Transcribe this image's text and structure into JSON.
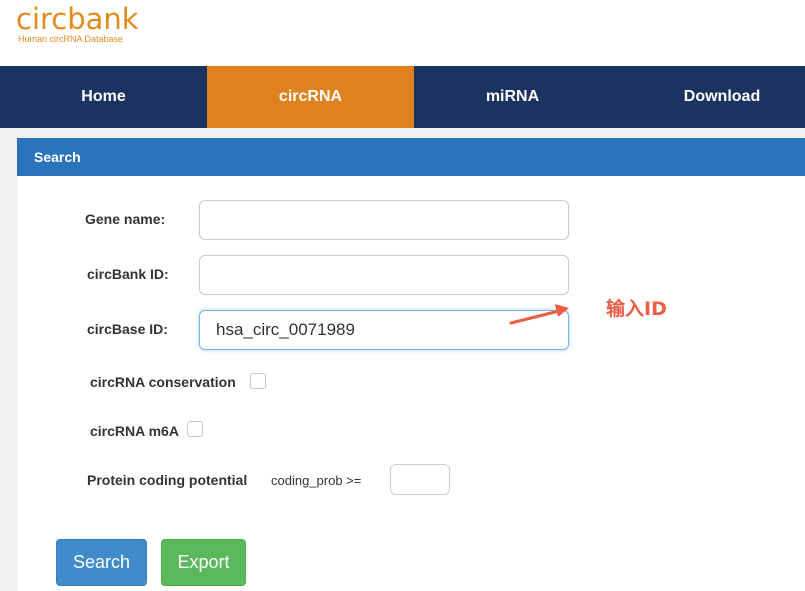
{
  "logo": {
    "name": "circbank",
    "tagline": "Human circRNA Database"
  },
  "nav": [
    {
      "label": "Home",
      "active": false
    },
    {
      "label": "circRNA",
      "active": true
    },
    {
      "label": "miRNA",
      "active": false
    },
    {
      "label": "Download",
      "active": false
    }
  ],
  "panel": {
    "title": "Search"
  },
  "form": {
    "gene_name_label": "Gene name:",
    "gene_name_value": "",
    "circbank_id_label": "circBank ID:",
    "circbank_id_value": "",
    "circbase_id_label": "circBase ID:",
    "circbase_id_value": "hsa_circ_0071989",
    "conservation_label": "circRNA conservation",
    "conservation_checked": false,
    "m6a_label": "circRNA m6A",
    "m6a_checked": false,
    "protein_coding_label": "Protein coding potential",
    "coding_prob_label": "coding_prob >=",
    "coding_prob_value": ""
  },
  "buttons": {
    "search": "Search",
    "export": "Export"
  },
  "annotation": {
    "text": "输入ID",
    "color": "#ec5d44"
  },
  "colors": {
    "brand": "#e58a22",
    "navbar": "#1b3360",
    "nav_active": "#e0811f",
    "panel_heading": "#2a74bb",
    "search_button": "#428bca",
    "export_button": "#5cb85c"
  }
}
